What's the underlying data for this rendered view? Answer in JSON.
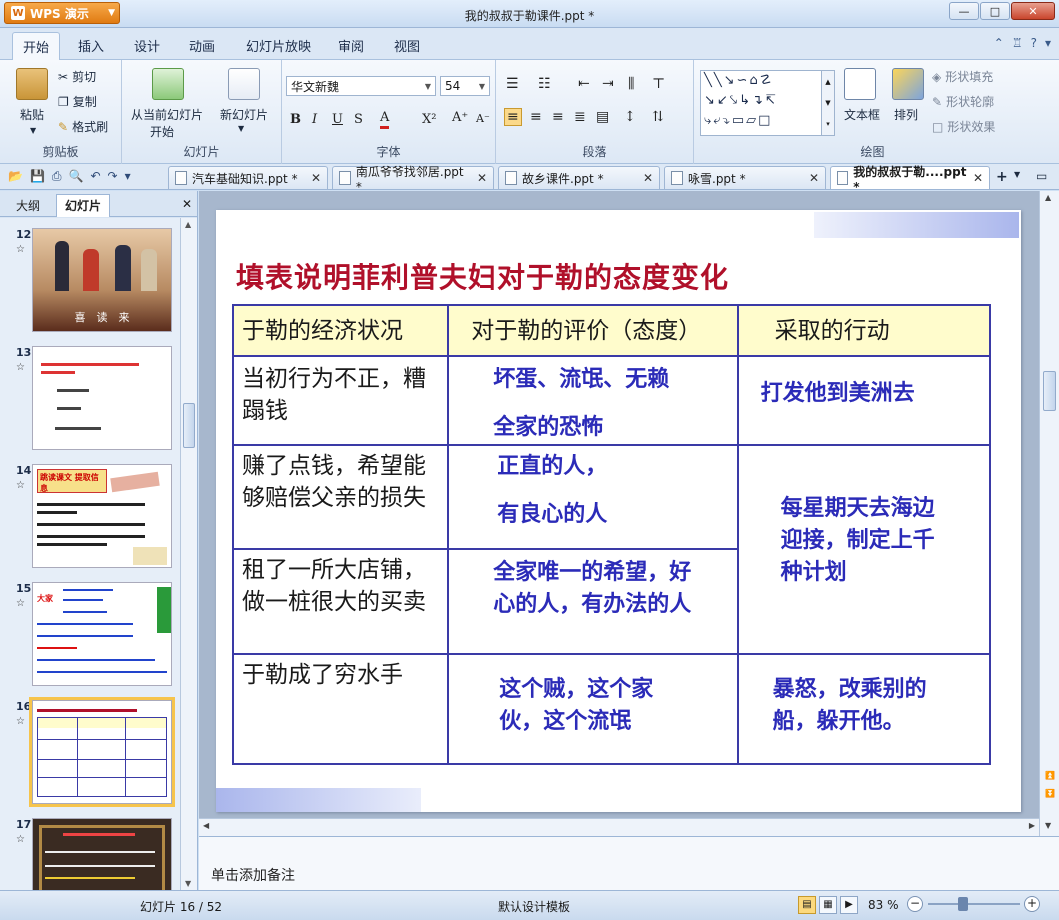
{
  "app": {
    "name": "WPS 演示",
    "window_title": "我的叔叔于勒课件.ppt *"
  },
  "menu": {
    "tabs": [
      "开始",
      "插入",
      "设计",
      "动画",
      "幻灯片放映",
      "审阅",
      "视图"
    ]
  },
  "ribbon": {
    "clipboard": {
      "group": "剪贴板",
      "paste": "粘贴",
      "cut": "剪切",
      "copy": "复制",
      "format_painter": "格式刷"
    },
    "slides": {
      "group": "幻灯片",
      "from_current_line1": "从当前幻灯片",
      "from_current_line2": "开始",
      "new_slide": "新幻灯片"
    },
    "font": {
      "group": "字体",
      "font_name": "华文新魏",
      "font_size": "54"
    },
    "paragraph": {
      "group": "段落"
    },
    "drawing": {
      "group": "绘图",
      "textbox": "文本框",
      "arrange": "排列",
      "shape_fill": "形状填充",
      "shape_outline": "形状轮廓",
      "shape_effect": "形状效果"
    }
  },
  "doc_tabs": [
    {
      "label": "汽车基础知识.ppt *",
      "active": false
    },
    {
      "label": "南瓜爷爷找邻居.ppt *",
      "active": false
    },
    {
      "label": "故乡课件.ppt *",
      "active": false
    },
    {
      "label": "咏雪.ppt *",
      "active": false
    },
    {
      "label": "我的叔叔于勒....ppt *",
      "active": true
    }
  ],
  "left_panel": {
    "tabs": [
      "大纲",
      "幻灯片"
    ],
    "thumbnails": [
      {
        "num": "12",
        "text": "喜　读　来"
      },
      {
        "num": "13",
        "text": ""
      },
      {
        "num": "14",
        "text": "跳读课文 提取信息"
      },
      {
        "num": "15",
        "text": "大家"
      },
      {
        "num": "16",
        "text": ""
      },
      {
        "num": "17",
        "text": ""
      }
    ]
  },
  "slide": {
    "title": "填表说明菲利普夫妇对于勒的态度变化",
    "headers": [
      "于勒的经济状况",
      "对于勒的评价（态度）",
      "采取的行动"
    ],
    "rows": [
      {
        "status": "当初行为不正，糟蹋钱",
        "eval1": "坏蛋、流氓、无赖",
        "eval2": "全家的恐怖",
        "action": "打发他到美洲去"
      },
      {
        "status": "赚了点钱，希望能够赔偿父亲的损失",
        "eval1": "正直的人，",
        "eval2": "有良心的人",
        "action": "每星期天去海边迎接，制定上千种计划"
      },
      {
        "status": "租了一所大店铺，做一桩很大的买卖",
        "eval1": "全家唯一的希望，好心的人，有办法的人",
        "eval2": ""
      },
      {
        "status": "于勒成了穷水手",
        "eval1": "这个贼，这个家伙，这个流氓",
        "eval2": "",
        "action": "暴怒，改乘别的船，躲开他。"
      }
    ]
  },
  "notes": {
    "placeholder": "单击添加备注"
  },
  "status": {
    "slide_count": "幻灯片 16 / 52",
    "template": "默认设计模板",
    "zoom": "83 %"
  },
  "colors": {
    "title_red": "#b0102a",
    "table_border": "#3a3aa6",
    "answer_blue": "#2b2bb8",
    "header_fill": "#fffccc"
  }
}
